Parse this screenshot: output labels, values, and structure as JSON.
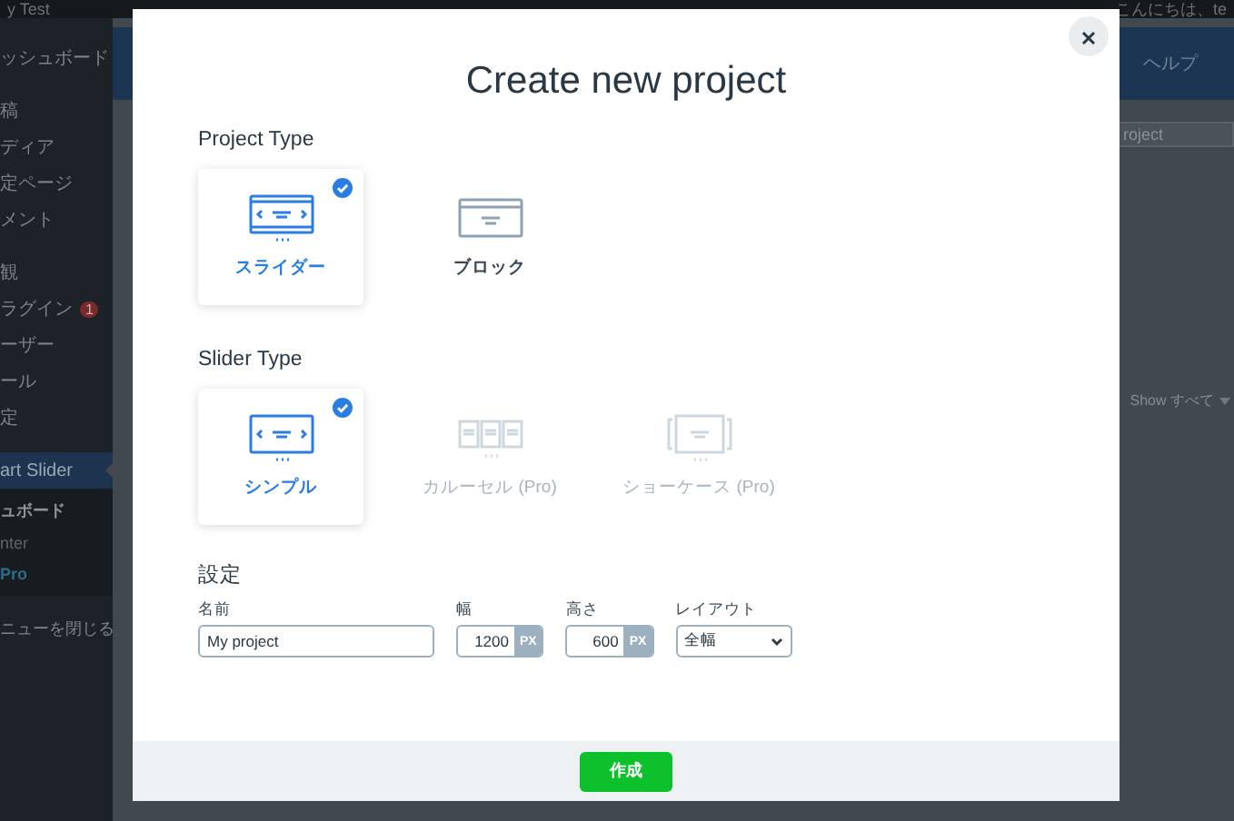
{
  "admin_bar": {
    "site": "y Test",
    "greeting": "こんにちは、te"
  },
  "sidebar": {
    "groups": [
      [
        {
          "label": "ッシュボード",
          "selected": false
        }
      ],
      [
        {
          "label": "稿",
          "selected": false
        },
        {
          "label": "ディア",
          "selected": false
        },
        {
          "label": "定ページ",
          "selected": false
        },
        {
          "label": "メント",
          "selected": false
        }
      ],
      [
        {
          "label": "観",
          "selected": false
        },
        {
          "label": "ラグイン",
          "selected": false,
          "badge": "1"
        },
        {
          "label": "ーザー",
          "selected": false
        },
        {
          "label": "ール",
          "selected": false
        },
        {
          "label": "定",
          "selected": false
        }
      ],
      [
        {
          "label": "art Slider",
          "selected": true
        }
      ]
    ],
    "submenu": [
      {
        "label": "ュボード",
        "kind": "current"
      },
      {
        "label": "nter",
        "kind": "plain"
      },
      {
        "label": "Pro",
        "kind": "highlight"
      }
    ],
    "collapse": "ニューを閉じる"
  },
  "header": {
    "tab": "ヘルプ"
  },
  "search": {
    "placeholder": "roject"
  },
  "filter": {
    "label": "Show すべて"
  },
  "modal": {
    "title": "Create new project",
    "project_type": {
      "label": "Project Type",
      "options": [
        {
          "label": "スライダー",
          "kind": "slider",
          "selected": true,
          "disabled": false
        },
        {
          "label": "ブロック",
          "kind": "block",
          "selected": false,
          "disabled": false
        }
      ]
    },
    "slider_type": {
      "label": "Slider Type",
      "options": [
        {
          "label": "シンプル",
          "kind": "simple",
          "selected": true,
          "disabled": false
        },
        {
          "label": "カルーセル (Pro)",
          "kind": "carousel",
          "selected": false,
          "disabled": true
        },
        {
          "label": "ショーケース (Pro)",
          "kind": "showcase",
          "selected": false,
          "disabled": true
        }
      ]
    },
    "settings": {
      "label": "設定",
      "name": {
        "label": "名前",
        "value": "My project"
      },
      "width": {
        "label": "幅",
        "value": "1200",
        "unit": "PX"
      },
      "height": {
        "label": "高さ",
        "value": "600",
        "unit": "PX"
      },
      "layout": {
        "label": "レイアウト",
        "value": "全幅"
      }
    },
    "submit": "作成"
  }
}
